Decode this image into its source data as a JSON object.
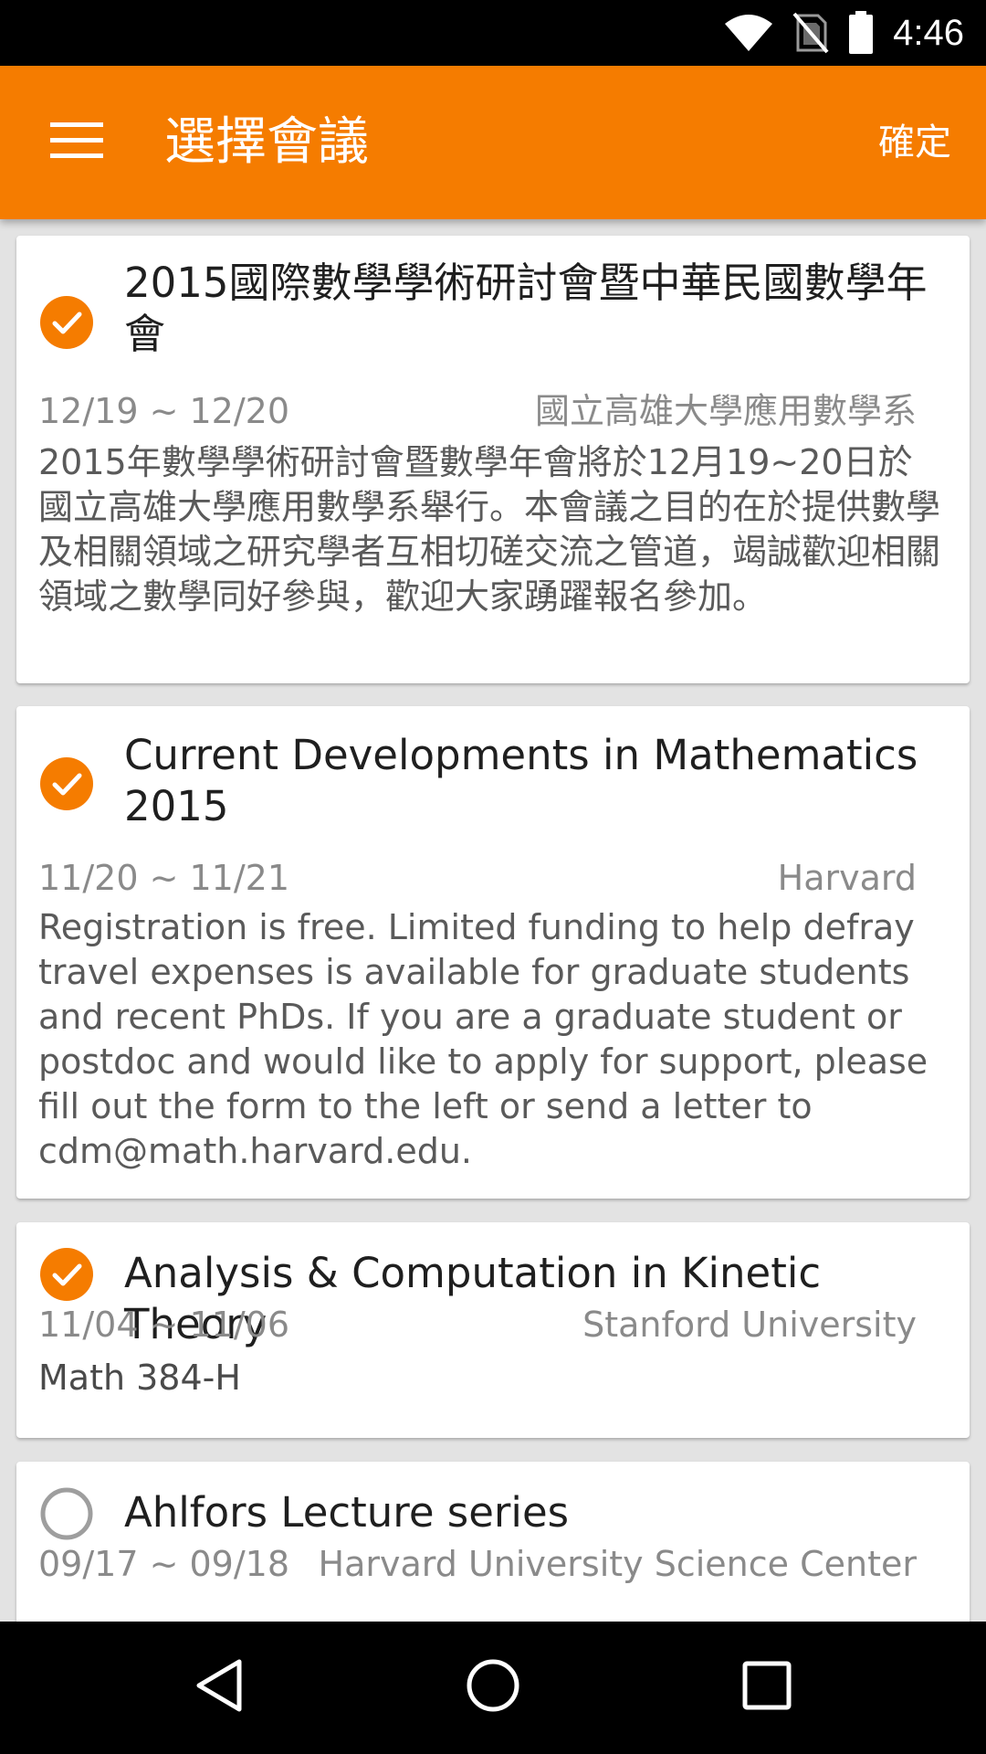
{
  "status_bar": {
    "time": "4:46",
    "icons": [
      "wifi-icon",
      "no-signal-icon",
      "battery-icon"
    ]
  },
  "app_bar": {
    "menu_icon": "menu-icon",
    "title": "選擇會議",
    "confirm_label": "確定",
    "background_color": "#f57c00"
  },
  "colors": {
    "accent": "#f57c00",
    "unchecked": "#9e9e9e"
  },
  "conferences": [
    {
      "checked": true,
      "title": "2015國際數學學術研討會暨中華民國數學年會",
      "date": "12/19 ~ 12/20",
      "location": "國立高雄大學應用數學系",
      "description": "2015年數學學術研討會暨數學年會將於12月19~20日於國立高雄大學應用數學系舉行。本會議之目的在於提供數學及相關領域之研究學者互相切磋交流之管道，竭誠歡迎相關領域之數學同好參與，歡迎大家踴躍報名參加。"
    },
    {
      "checked": true,
      "title": "Current Developments in Mathematics 2015",
      "date": "11/20 ~ 11/21",
      "location": "Harvard",
      "description": "Registration is free. Limited funding to help defray travel expenses is available for graduate students and recent PhDs. If you are a graduate student or postdoc and would like to apply for support, please fill out the form to the left or send a letter to cdm@math.harvard.edu."
    },
    {
      "checked": true,
      "title": "Analysis & Computation in Kinetic Theory",
      "date": "11/04 ~ 11/06",
      "location": "Stanford University",
      "description": "Math 384-H"
    },
    {
      "checked": false,
      "title": "Ahlfors Lecture series",
      "date": "09/17 ~ 09/18",
      "location": "Harvard University Science Center",
      "description": ""
    }
  ],
  "nav_bar": {
    "buttons": [
      "back-icon",
      "home-icon",
      "recents-icon"
    ]
  }
}
